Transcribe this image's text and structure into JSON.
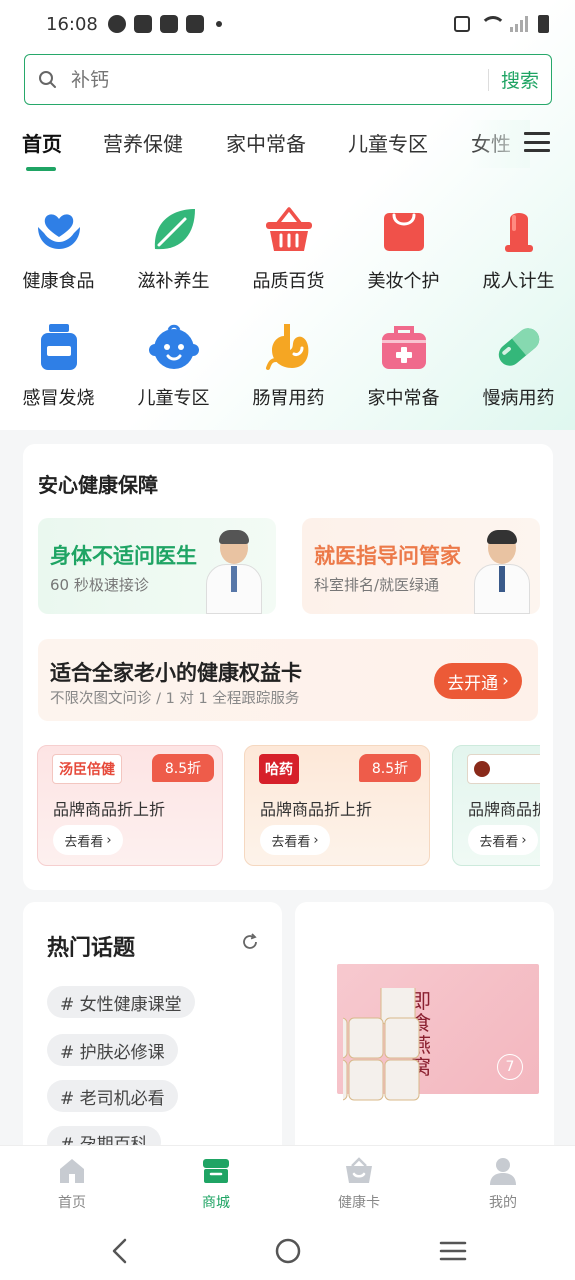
{
  "status_bar": {
    "time": "16:08"
  },
  "search": {
    "placeholder": "补钙",
    "button_label": "搜索"
  },
  "tabs": [
    {
      "label": "首页",
      "active": true
    },
    {
      "label": "营养保健"
    },
    {
      "label": "家中常备"
    },
    {
      "label": "儿童专区"
    },
    {
      "label": "女性"
    }
  ],
  "categories": [
    {
      "label": "健康食品",
      "icon": "heart-hands-icon"
    },
    {
      "label": "滋补养生",
      "icon": "leaf-icon"
    },
    {
      "label": "品质百货",
      "icon": "basket-icon"
    },
    {
      "label": "美妆个护",
      "icon": "shopping-bag-icon"
    },
    {
      "label": "成人计生",
      "icon": "condom-icon"
    },
    {
      "label": "感冒发烧",
      "icon": "medicine-bottle-icon"
    },
    {
      "label": "儿童专区",
      "icon": "baby-face-icon"
    },
    {
      "label": "肠胃用药",
      "icon": "stomach-icon"
    },
    {
      "label": "家中常备",
      "icon": "first-aid-kit-icon"
    },
    {
      "label": "慢病用药",
      "icon": "capsule-icon"
    }
  ],
  "health_section": {
    "title": "安心健康保障",
    "doctor_card": {
      "title": "身体不适问医生",
      "subtitle": "60 秒极速接诊"
    },
    "manager_card": {
      "title": "就医指导问管家",
      "subtitle": "科室排名/就医绿通"
    },
    "benefit_card": {
      "title": "适合全家老小的健康权益卡",
      "subtitle": "不限次图文问诊 / 1 对 1 全程跟踪服务",
      "button_label": "去开通"
    },
    "coupons": [
      {
        "brand": "汤臣倍健",
        "badge": "8.5折",
        "title": "品牌商品折上折",
        "button_label": "去看看"
      },
      {
        "brand": "哈药",
        "badge": "8.5折",
        "title": "品牌商品折上折",
        "button_label": "去看看"
      },
      {
        "brand": "",
        "badge": "",
        "title": "品牌商品折上折",
        "button_label": "去看看"
      }
    ]
  },
  "hot_topics": {
    "title": "热门话题",
    "tags": [
      "# 女性健康课堂",
      "# 护肤必修课",
      "# 老司机必看",
      "# 孕期百科"
    ]
  },
  "product_card": {
    "box_text": "即食燕窝"
  },
  "bottom_nav": [
    {
      "label": "首页",
      "icon": "home-icon"
    },
    {
      "label": "商城",
      "icon": "store-icon",
      "active": true
    },
    {
      "label": "健康卡",
      "icon": "basket-card-icon"
    },
    {
      "label": "我的",
      "icon": "person-icon"
    }
  ],
  "colors": {
    "brand_green": "#1fa464",
    "accent_orange": "#ec5a37",
    "badge_red": "#ee5c4a"
  }
}
